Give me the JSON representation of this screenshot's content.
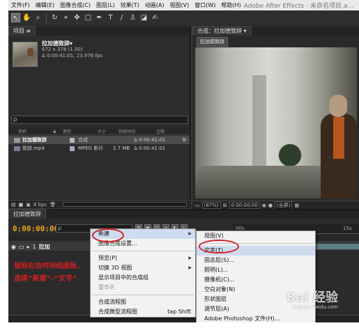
{
  "window": {
    "title": "Adobe After Effects - 未命名项目.a..."
  },
  "menubar": [
    "文件(F)",
    "编辑(E)",
    "图像合成(C)",
    "图层(L)",
    "效果(T)",
    "动画(A)",
    "视图(V)",
    "窗口(W)",
    "帮助(H)"
  ],
  "project": {
    "tab_label": "项目 ≡",
    "item_name": "拉加德致辞▾",
    "item_dims": "672 x 378 (1.00)",
    "item_duration": "Δ 0:00:41:01, 23.976 fps",
    "search_placeholder": "ρ",
    "columns": [
      "名称",
      "▲",
      "类型",
      "大小",
      "持续时间",
      "注释"
    ],
    "rows": [
      {
        "name": "拉加德致辞",
        "type": "合成",
        "size": "",
        "duration": "Δ 0:00:41:01",
        "selected": true
      },
      {
        "name": "致辞.mp4",
        "type": "MPEG 影片",
        "size": "2.7 MB",
        "duration": "Δ 0:00:41:01",
        "selected": false
      }
    ],
    "bpc": "8 bpc"
  },
  "composition": {
    "tab_label": "合成：拉加德致辞 ▾",
    "subtab": "拉加德致辞",
    "zoom": "(87%)",
    "timecode": "0:00:00:00",
    "view": "(全屏)"
  },
  "timeline": {
    "tab_label": "拉加德致辞",
    "timecode": "0:00:00:00",
    "search_placeholder": "ρ",
    "ruler_start": "00s",
    "ruler_end": "15s",
    "layer_index": "1",
    "layer_name": "拉加",
    "annotation": "鼠标右击时间线面板，选择“新建”-“文字”"
  },
  "context_menu": {
    "items": [
      {
        "label": "新建",
        "arrow": "▶",
        "highlight": true
      },
      {
        "label": "图像合成设置..."
      },
      {
        "sep": true
      },
      {
        "label": "预览(P)",
        "arrow": "▶"
      },
      {
        "label": "切换 3D 视图",
        "arrow": "▶"
      },
      {
        "label": "显示项目中的合成组"
      },
      {
        "label": "重命名",
        "disabled": true
      },
      {
        "sep": true
      },
      {
        "label": "合成流程图"
      },
      {
        "label": "合成微型流程图",
        "shortcut": "tap Shift"
      }
    ]
  },
  "submenu": {
    "items": [
      {
        "label": "视图(V)"
      },
      {
        "sep": true
      },
      {
        "label": "文字(T)",
        "highlight": true
      },
      {
        "label": "固态层(S)..."
      },
      {
        "label": "照明(L)..."
      },
      {
        "label": "摄像机(C)..."
      },
      {
        "label": "空白对象(N)"
      },
      {
        "label": "形状图层"
      },
      {
        "label": "调节层(A)"
      },
      {
        "label": "Adobe Photoshop 文件(H)..."
      }
    ]
  },
  "watermark": {
    "text": "Bai 经验",
    "sub": "jingyan.baidu.com"
  },
  "colors": {
    "highlight_ring": "#d4232a",
    "timecode": "#e8a21c",
    "annotation": "#d02020"
  }
}
